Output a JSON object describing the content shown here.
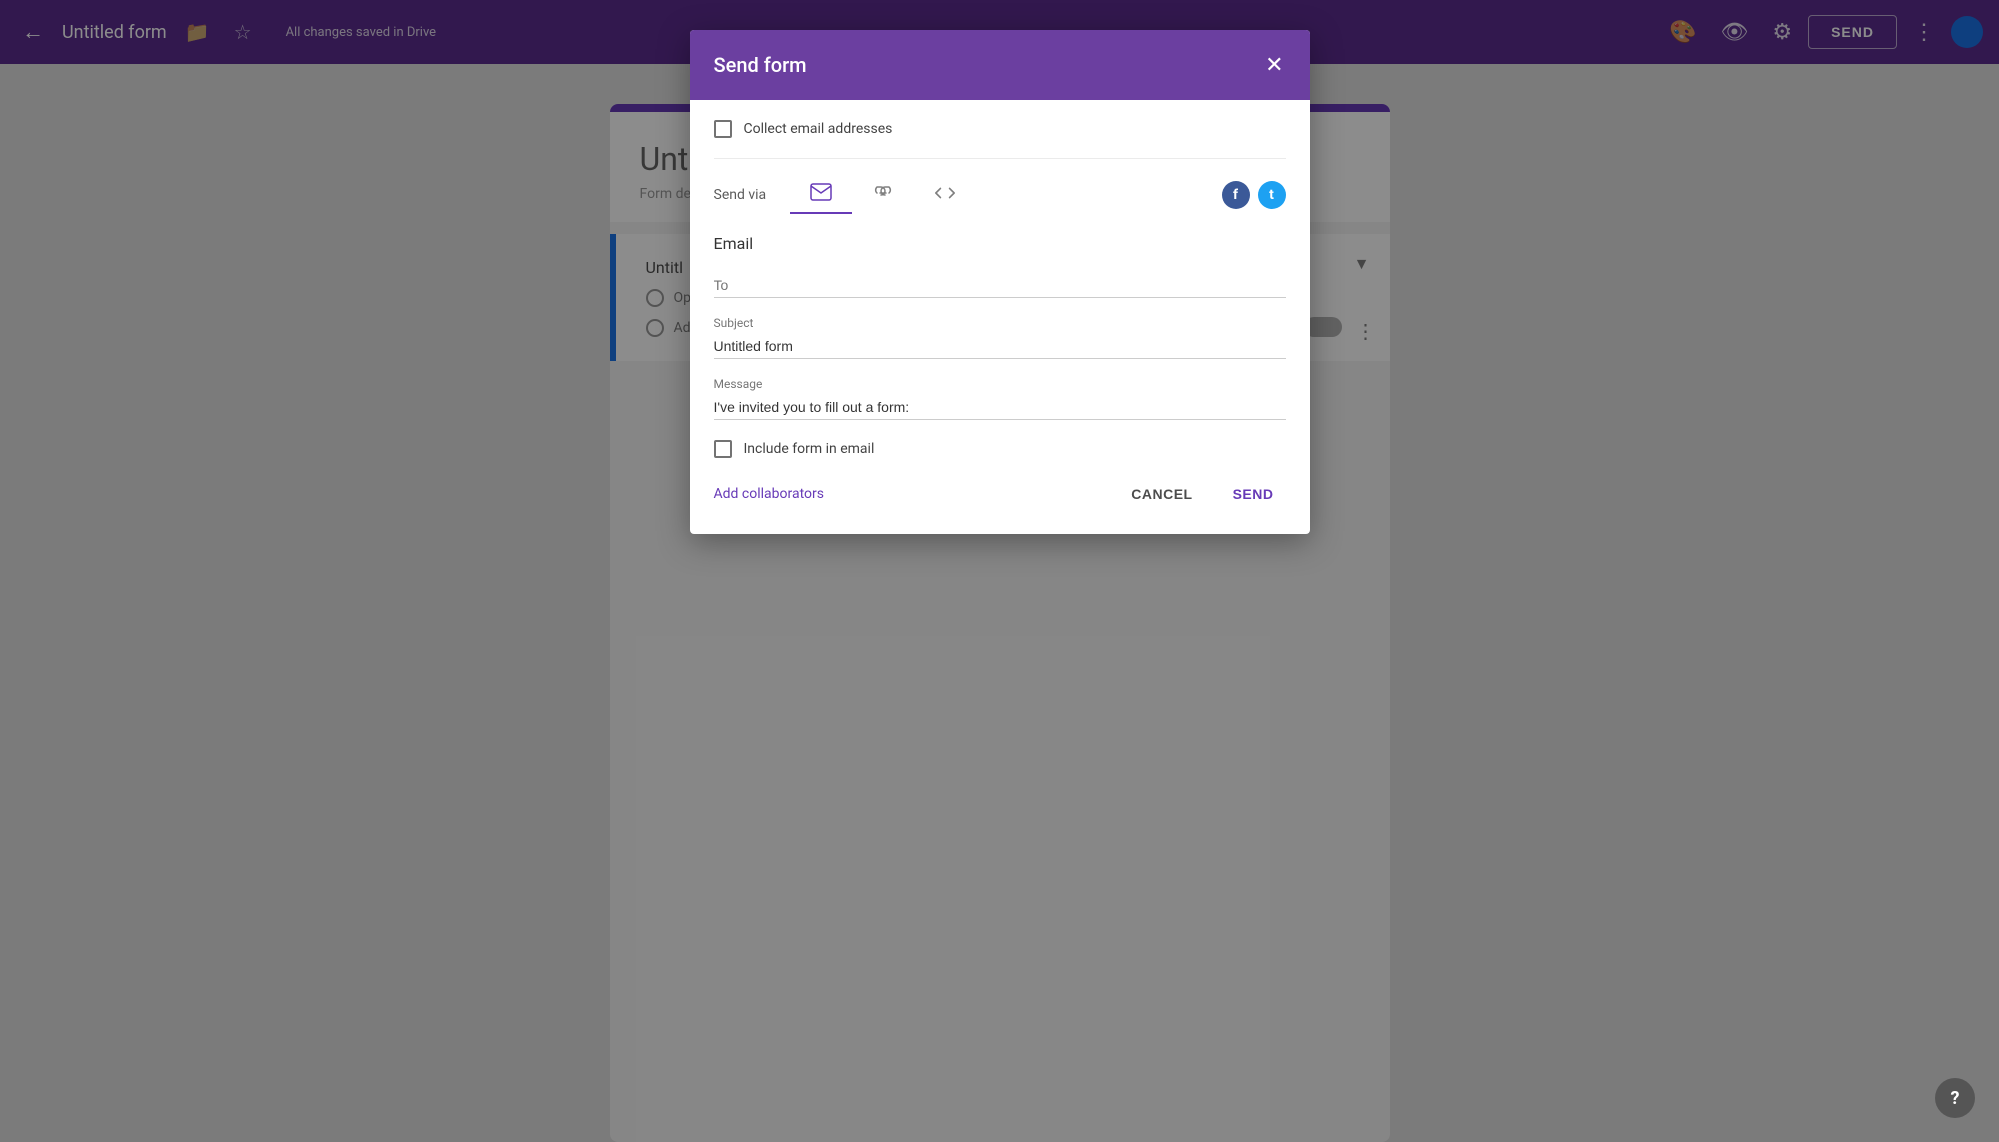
{
  "topbar": {
    "back_icon": "←",
    "title": "Untitled form",
    "folder_icon": "📁",
    "star_icon": "☆",
    "auto_save_text": "All changes saved in Drive",
    "palette_icon": "🎨",
    "eye_icon": "👁",
    "gear_icon": "⚙",
    "send_label": "SEND",
    "more_icon": "⋮"
  },
  "background_form": {
    "title": "Unt",
    "description": "Form de",
    "question_title": "Untitl",
    "option1": "Op",
    "option2": "Ad"
  },
  "dialog": {
    "title": "Send form",
    "close_icon": "✕",
    "collect_email_label": "Collect email addresses",
    "send_via_label": "Send via",
    "email_icon": "✉",
    "link_icon": "🔗",
    "embed_icon": "<>",
    "facebook_label": "f",
    "twitter_label": "t",
    "email_section_title": "Email",
    "to_placeholder": "To",
    "subject_label": "Subject",
    "subject_value": "Untitled form",
    "message_label": "Message",
    "message_value": "I've invited you to fill out a form:",
    "include_form_label": "Include form in email",
    "add_collaborators_label": "Add collaborators",
    "cancel_label": "CANCEL",
    "send_label": "SEND"
  },
  "help": {
    "icon": "?"
  }
}
